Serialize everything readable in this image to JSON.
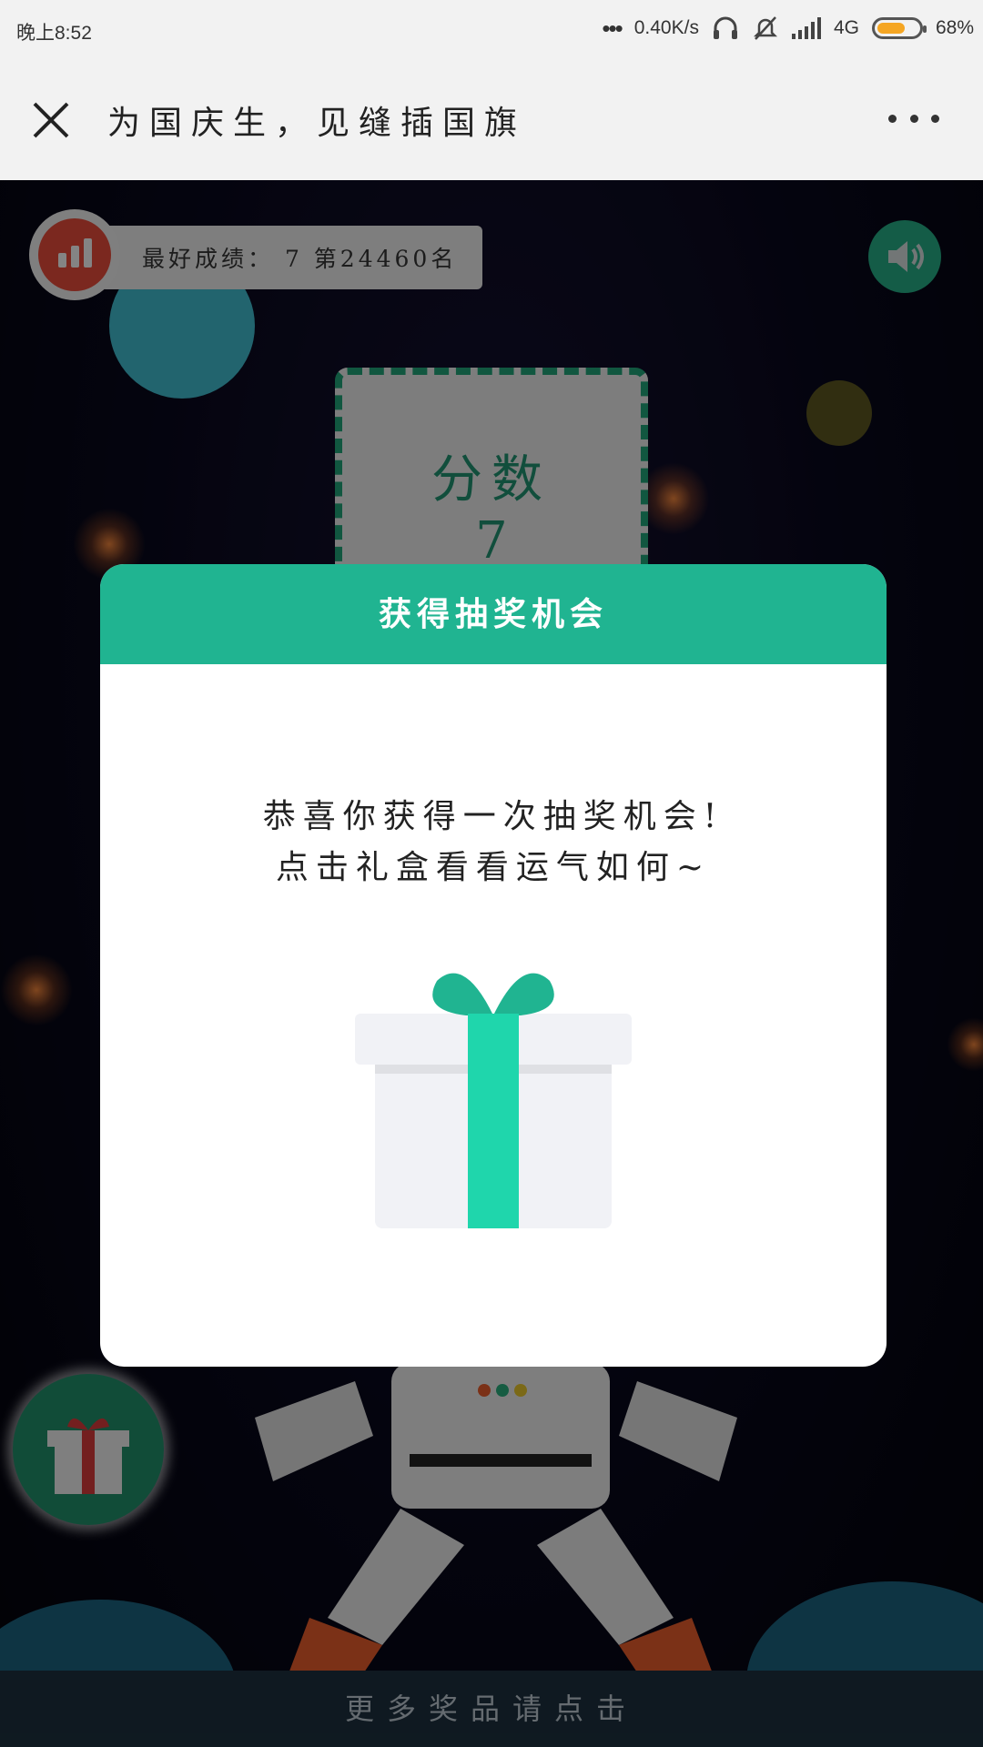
{
  "status_bar": {
    "time": "晚上8:52",
    "net_speed": "0.40K/s",
    "network": "4G",
    "battery_percent": "68%",
    "battery_level": 0.68,
    "icons": [
      "more-dots-icon",
      "headphones-icon",
      "mute-bell-icon",
      "signal-icon",
      "battery-icon"
    ]
  },
  "header": {
    "title": "为国庆生，见缝插国旗",
    "close_icon": "close-icon",
    "more_icon": "more-icon"
  },
  "game": {
    "best_score_text": "最好成绩：  7   第24460名",
    "score_label": "分数",
    "score_value": "7",
    "bottom_link": "更多奖品请点击",
    "colors": {
      "accent": "#20b491",
      "rank_button": "#e04a3a",
      "score_border": "#1f9e76"
    }
  },
  "modal": {
    "title": "获得抽奖机会",
    "message_line1": "恭喜你获得一次抽奖机会!",
    "message_line2": "点击礼盒看看运气如何~",
    "gift_icon": "gift-box-icon"
  }
}
